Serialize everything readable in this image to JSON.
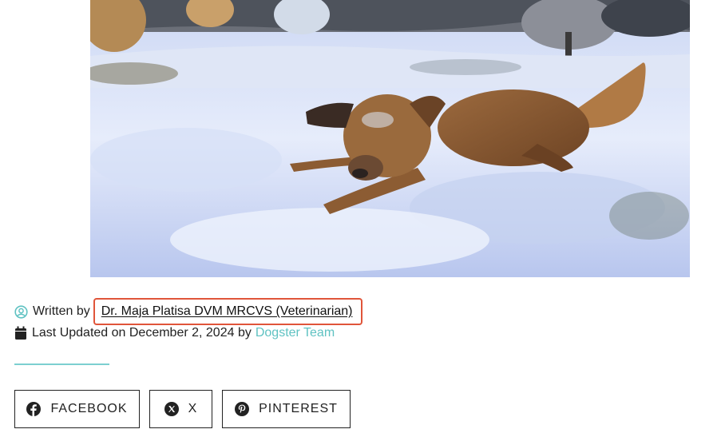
{
  "hero_image": {
    "alt": "Brown dog lying in snow",
    "icon": "dog-in-snow-photo"
  },
  "byline": {
    "written_prefix": "Written by",
    "author": "Dr. Maja Platisa DVM MRCVS (Veterinarian)",
    "updated_prefix": "Last Updated on December 2, 2024 by",
    "updated_by": "Dogster Team"
  },
  "share": {
    "facebook_label": "FACEBOOK",
    "x_label": "X",
    "pinterest_label": "PINTEREST"
  },
  "colors": {
    "accent_teal": "#5fc2c2",
    "highlight_border": "#e0553a"
  }
}
